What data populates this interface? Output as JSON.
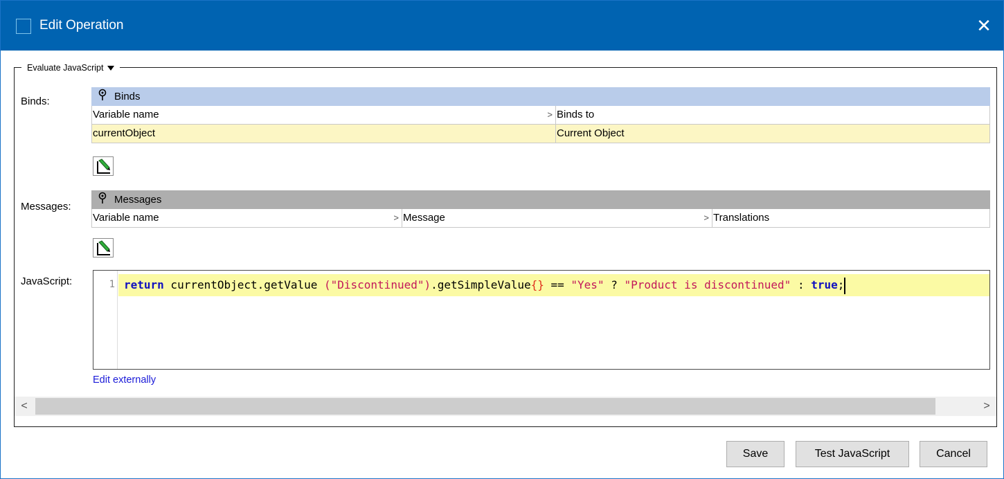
{
  "window": {
    "title": "Edit Operation",
    "close_glyph": "✕"
  },
  "operation_type": "Evaluate JavaScript",
  "binds": {
    "label": "Binds:",
    "header_title": "Binds",
    "columns": [
      "Variable name",
      "Binds to"
    ],
    "rows": [
      {
        "variable_name": "currentObject",
        "binds_to": "Current Object"
      }
    ]
  },
  "messages": {
    "label": "Messages:",
    "header_title": "Messages",
    "columns": [
      "Variable name",
      "Message",
      "Translations"
    ]
  },
  "javascript": {
    "label": "JavaScript:",
    "line_number": "1",
    "tokens": {
      "keyword": "return",
      "t1": " currentObject.getValue ",
      "t2": "(\"Discontinued\")",
      "t3": ".getSimpleValue",
      "t4": "{}",
      "t5": " == ",
      "t6": "\"Yes\"",
      "t7": " ? ",
      "t8": "\"Product is discontinued\"",
      "t9": " : ",
      "t10": "true",
      "t11": ";"
    },
    "edit_externally_label": "Edit externally"
  },
  "buttons": {
    "save": "Save",
    "test": "Test JavaScript",
    "cancel": "Cancel"
  },
  "icons": {
    "pin": "pin-icon",
    "edit": "pencil-edit-icon",
    "dropdown": "triangle-down-icon"
  },
  "colors": {
    "titlebar": "#0063b1",
    "binds_header": "#b9ccea",
    "messages_header": "#aeaeae",
    "selected_row": "#fcf6c4",
    "code_highlight": "#fbfaa4"
  }
}
